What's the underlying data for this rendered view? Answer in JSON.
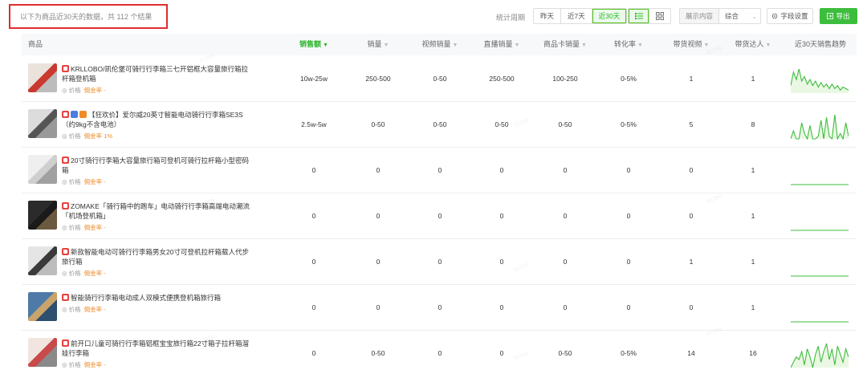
{
  "summary": {
    "text": "以下为商品近30天的数据，共 112 个结果"
  },
  "toolbar": {
    "period_label": "统计周期",
    "periods": [
      {
        "label": "昨天",
        "active": false
      },
      {
        "label": "近7天",
        "active": false
      },
      {
        "label": "近30天",
        "active": true
      }
    ],
    "display_label": "展示内容",
    "display_value": "综合",
    "field_settings_label": "字段设置",
    "export_label": "导出"
  },
  "table": {
    "columns": [
      {
        "label": "商品",
        "sortable": false
      },
      {
        "label": "销售额",
        "sortable": true,
        "sorted": true
      },
      {
        "label": "销量",
        "sortable": true
      },
      {
        "label": "视频销量",
        "sortable": true
      },
      {
        "label": "直播销量",
        "sortable": true
      },
      {
        "label": "商品卡销量",
        "sortable": true
      },
      {
        "label": "转化率",
        "sortable": true
      },
      {
        "label": "带货视频",
        "sortable": true
      },
      {
        "label": "带货达人",
        "sortable": true
      },
      {
        "label": "近30天销售趋势",
        "sortable": false
      }
    ],
    "rows": [
      {
        "title": "KRLLOBO/凯伦堡可骑行行李箱三七开铝框大容量旅行箱拉杆箱登机箱",
        "badges": [],
        "price_label": "价格",
        "commission_label": "佣金率 -",
        "sales_amount": "10w-25w",
        "sales": "250-500",
        "video_sales": "0-50",
        "live_sales": "250-500",
        "card_sales": "100-250",
        "conversion": "0-5%",
        "videos": "1",
        "creators": "1",
        "trend": [
          5,
          14,
          9,
          16,
          8,
          11,
          6,
          9,
          5,
          8,
          4,
          7,
          4,
          6,
          3,
          6,
          3,
          5,
          2,
          4,
          3,
          2
        ],
        "thumb_colors": [
          "#e9e3dc",
          "#c9392f",
          "#bcbcbc"
        ]
      },
      {
        "title": "【狂欢价】爱尔威20英寸智能电动骑行行李箱SE3S（约9kg不含电池）",
        "badges": [
          "#4a7de2",
          "#f08a24"
        ],
        "price_label": "价格",
        "commission_label": "佣金率 1%",
        "sales_amount": "2.5w-5w",
        "sales": "0-50",
        "video_sales": "0-50",
        "live_sales": "0-50",
        "card_sales": "0-50",
        "conversion": "0-5%",
        "videos": "5",
        "creators": "8",
        "trend": [
          0,
          3,
          0,
          0,
          6,
          2,
          0,
          5,
          0,
          0,
          1,
          7,
          0,
          8,
          1,
          0,
          9,
          0,
          2,
          0,
          6,
          1
        ],
        "thumb_colors": [
          "#dcdcdc",
          "#555555",
          "#999999"
        ]
      },
      {
        "title": "20寸骑行行李箱大容量旅行箱可登机可骑行拉杆箱小型密码箱",
        "badges": [],
        "price_label": "价格",
        "commission_label": "佣金率 -",
        "sales_amount": "0",
        "sales": "0",
        "video_sales": "0",
        "live_sales": "0",
        "card_sales": "0",
        "conversion": "0",
        "videos": "0",
        "creators": "1",
        "trend": [
          0,
          0,
          0,
          0,
          0,
          0,
          0,
          0,
          0,
          0,
          0,
          0,
          0,
          0,
          0,
          0,
          0,
          0,
          0,
          0,
          0,
          0
        ],
        "thumb_colors": [
          "#efefef",
          "#cfcfcf",
          "#a0a0a0"
        ]
      },
      {
        "title": "ZOMAKE「骑行箱中的跑车」电动骑行行李箱高端电动潮流「机场登机箱」",
        "badges": [],
        "price_label": "价格",
        "commission_label": "佣金率 -",
        "sales_amount": "0",
        "sales": "0",
        "video_sales": "0",
        "live_sales": "0",
        "card_sales": "0",
        "conversion": "0",
        "videos": "0",
        "creators": "1",
        "trend": [
          0,
          0,
          0,
          0,
          0,
          0,
          0,
          0,
          0,
          0,
          0,
          0,
          0,
          0,
          0,
          0,
          0,
          0,
          0,
          0,
          0,
          0
        ],
        "thumb_colors": [
          "#2b2b2b",
          "#1a1a1a",
          "#6b5a3e"
        ]
      },
      {
        "title": "新款智能电动可骑行行李箱男女20寸可登机拉杆箱载人代步旅行箱",
        "badges": [],
        "price_label": "价格",
        "commission_label": "佣金率 -",
        "sales_amount": "0",
        "sales": "0",
        "video_sales": "0",
        "live_sales": "0",
        "card_sales": "0",
        "conversion": "0",
        "videos": "1",
        "creators": "1",
        "trend": [
          0,
          0,
          0,
          0,
          0,
          0,
          0,
          0,
          0,
          0,
          0,
          0,
          0,
          0,
          0,
          0,
          0,
          0,
          0,
          0,
          0,
          0
        ],
        "thumb_colors": [
          "#e5e5e5",
          "#3a3a3a",
          "#bdbdbd"
        ]
      },
      {
        "title": "智能骑行行李箱电动成人双模式便携登机箱旅行箱",
        "badges": [],
        "price_label": "价格",
        "commission_label": "佣金率 -",
        "sales_amount": "0",
        "sales": "0",
        "video_sales": "0",
        "live_sales": "0",
        "card_sales": "0",
        "conversion": "0",
        "videos": "0",
        "creators": "1",
        "trend": [
          0,
          0,
          0,
          0,
          0,
          0,
          0,
          0,
          0,
          0,
          0,
          0,
          0,
          0,
          0,
          0,
          0,
          0,
          0,
          0,
          0,
          0
        ],
        "thumb_colors": [
          "#4d7aa6",
          "#c9a46a",
          "#2f4f6f"
        ]
      },
      {
        "title": "前开口儿童可骑行行李箱铝框宝宝旅行箱22寸箱子拉杆箱溜娃行李箱",
        "badges": [],
        "price_label": "价格",
        "commission_label": "佣金率 -",
        "sales_amount": "0",
        "sales": "0-50",
        "video_sales": "0",
        "live_sales": "0",
        "card_sales": "0-50",
        "conversion": "0-5%",
        "videos": "14",
        "creators": "16",
        "trend": [
          0,
          2,
          4,
          3,
          6,
          1,
          7,
          4,
          0,
          5,
          8,
          2,
          6,
          9,
          3,
          7,
          1,
          8,
          5,
          2,
          7,
          4
        ],
        "thumb_colors": [
          "#f1e6df",
          "#c94a4a",
          "#8a8a8a"
        ]
      }
    ]
  },
  "colors": {
    "accent": "#3dbd3d",
    "highlight_border": "#e02d2d",
    "commission": "#f08a24",
    "pdd": "#e64340"
  }
}
